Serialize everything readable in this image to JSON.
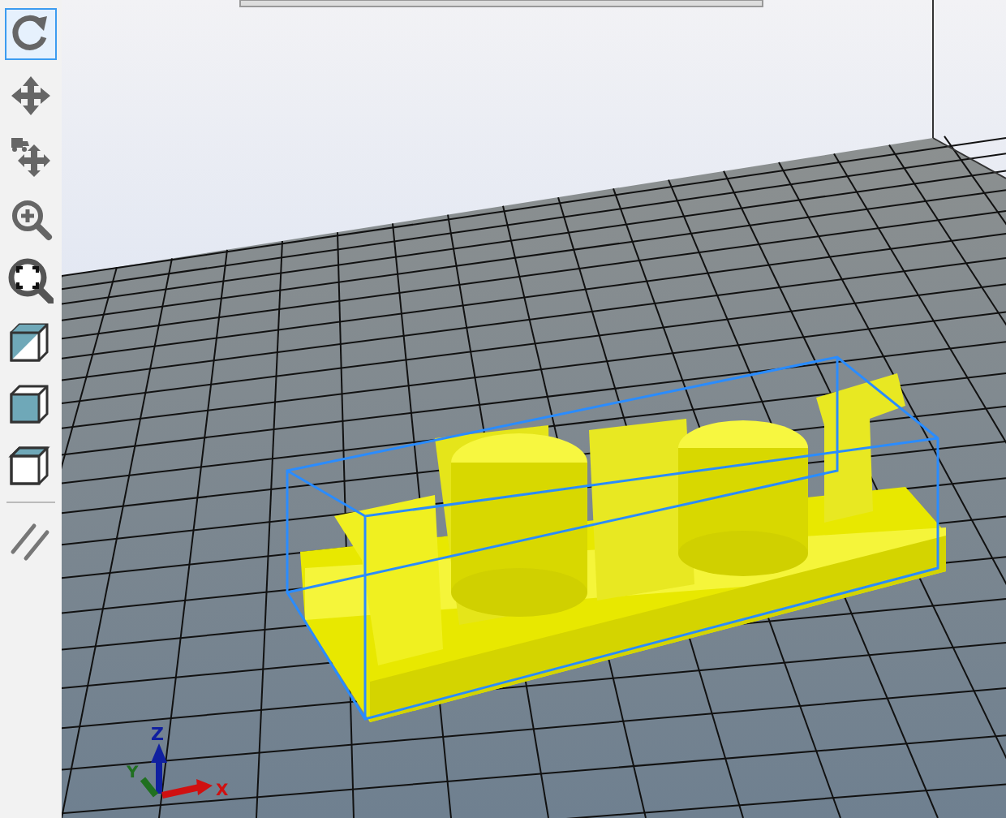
{
  "toolbar": {
    "items": [
      {
        "kind": "rotate",
        "selected": true
      },
      {
        "kind": "move",
        "selected": false
      },
      {
        "kind": "move-object",
        "selected": false
      },
      {
        "kind": "zoom",
        "selected": false
      },
      {
        "kind": "fit",
        "selected": false
      },
      {
        "kind": "iso-view",
        "selected": false
      },
      {
        "kind": "front-view",
        "selected": false
      },
      {
        "kind": "top-view",
        "selected": false
      },
      {
        "kind": "separator"
      },
      {
        "kind": "parallel",
        "selected": false
      }
    ]
  },
  "viewport": {
    "axes": {
      "x": "X",
      "y": "Y",
      "z": "Z"
    }
  }
}
